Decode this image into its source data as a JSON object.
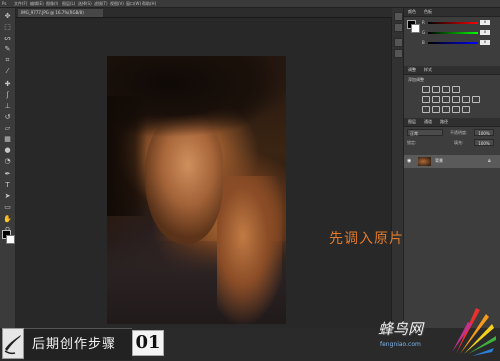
{
  "window": {
    "menu_items": [
      "文件(F)",
      "编辑(E)",
      "图像(I)",
      "图层(L)",
      "选择(S)",
      "滤镜(T)",
      "视图(V)",
      "窗口(W)",
      "帮助(H)"
    ]
  },
  "document_tab": {
    "label": "IMG_9777.JPG @ 16.7%(RGB/8)"
  },
  "panels": {
    "color": {
      "tabs": [
        "颜色",
        "色板"
      ],
      "sliders": [
        {
          "label": "R",
          "value": "0",
          "color": "#e04040"
        },
        {
          "label": "G",
          "value": "0",
          "color": "#40c040"
        },
        {
          "label": "B",
          "value": "0",
          "color": "#4060e0"
        }
      ]
    },
    "adjustments": {
      "tabs": [
        "调整",
        "样式"
      ],
      "heading": "添加调整"
    },
    "layers": {
      "tabs": [
        "图层",
        "通道",
        "路径"
      ],
      "blend_mode": "正常",
      "opacity_label": "不透明度:",
      "opacity_value": "100%",
      "lock_label": "锁定:",
      "fill_label": "填充:",
      "fill_value": "100%",
      "layer_name": "背景"
    }
  },
  "annotation": "先调入原片",
  "banner": {
    "title": "后期创作步骤",
    "step": "01"
  },
  "watermark": {
    "site": "蜂鸟网",
    "url": "fengniao.com"
  },
  "icons": [
    "move-icon",
    "marquee-icon",
    "lasso-icon",
    "quick-select-icon",
    "crop-icon",
    "eyedropper-icon",
    "healing-icon",
    "brush-icon",
    "stamp-icon",
    "history-brush-icon",
    "eraser-icon",
    "gradient-icon",
    "blur-icon",
    "dodge-icon",
    "pen-icon",
    "type-icon",
    "path-select-icon",
    "shape-icon",
    "hand-icon",
    "zoom-icon"
  ]
}
